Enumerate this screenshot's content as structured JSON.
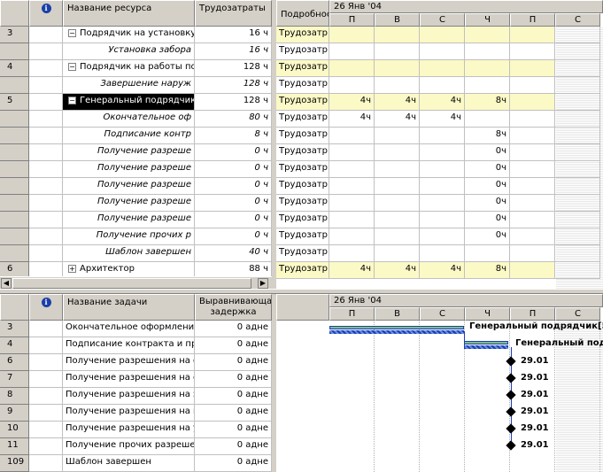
{
  "top": {
    "columns": {
      "name": "Название ресурса",
      "work": "Трудозатраты",
      "details": "Подробнос"
    },
    "timescale": {
      "week": "26 Янв '04",
      "days": [
        "П",
        "В",
        "С",
        "Ч",
        "П",
        "С"
      ]
    },
    "rows": [
      {
        "id": "3",
        "name": "Подрядчик на установку",
        "work": "16 ч",
        "detail": "Трудозатр",
        "cells": [
          "",
          "",
          "",
          "",
          "",
          ""
        ]
      },
      {
        "id": "",
        "name": "Установка забора",
        "work": "16 ч",
        "detail": "Трудозатр",
        "cells": [
          "",
          "",
          "",
          "",
          "",
          ""
        ]
      },
      {
        "id": "4",
        "name": "Подрядчик на работы по",
        "work": "128 ч",
        "detail": "Трудозатр",
        "cells": [
          "",
          "",
          "",
          "",
          "",
          ""
        ]
      },
      {
        "id": "",
        "name": "Завершение наруж",
        "work": "128 ч",
        "detail": "Трудозатр",
        "cells": [
          "",
          "",
          "",
          "",
          "",
          ""
        ]
      },
      {
        "id": "5",
        "name": "Генеральный подрядчик",
        "work": "128 ч",
        "detail": "Трудозатр",
        "cells": [
          "4ч",
          "4ч",
          "4ч",
          "8ч",
          "",
          ""
        ]
      },
      {
        "id": "",
        "name": "Окончательное оф",
        "work": "80 ч",
        "detail": "Трудозатр",
        "cells": [
          "4ч",
          "4ч",
          "4ч",
          "",
          "",
          ""
        ]
      },
      {
        "id": "",
        "name": "Подписание контр",
        "work": "8 ч",
        "detail": "Трудозатр",
        "cells": [
          "",
          "",
          "",
          "8ч",
          "",
          ""
        ]
      },
      {
        "id": "",
        "name": "Получение разреше",
        "work": "0 ч",
        "detail": "Трудозатр",
        "cells": [
          "",
          "",
          "",
          "0ч",
          "",
          ""
        ]
      },
      {
        "id": "",
        "name": "Получение разреше",
        "work": "0 ч",
        "detail": "Трудозатр",
        "cells": [
          "",
          "",
          "",
          "0ч",
          "",
          ""
        ]
      },
      {
        "id": "",
        "name": "Получение разреше",
        "work": "0 ч",
        "detail": "Трудозатр",
        "cells": [
          "",
          "",
          "",
          "0ч",
          "",
          ""
        ]
      },
      {
        "id": "",
        "name": "Получение разреше",
        "work": "0 ч",
        "detail": "Трудозатр",
        "cells": [
          "",
          "",
          "",
          "0ч",
          "",
          ""
        ]
      },
      {
        "id": "",
        "name": "Получение разреше",
        "work": "0 ч",
        "detail": "Трудозатр",
        "cells": [
          "",
          "",
          "",
          "0ч",
          "",
          ""
        ]
      },
      {
        "id": "",
        "name": "Получение прочих р",
        "work": "0 ч",
        "detail": "Трудозатр",
        "cells": [
          "",
          "",
          "",
          "0ч",
          "",
          ""
        ]
      },
      {
        "id": "",
        "name": "Шаблон завершен",
        "work": "40 ч",
        "detail": "Трудозатр",
        "cells": [
          "",
          "",
          "",
          "",
          "",
          ""
        ]
      },
      {
        "id": "6",
        "name": "Архитектор",
        "work": "88 ч",
        "detail": "Трудозатр",
        "cells": [
          "4ч",
          "4ч",
          "4ч",
          "8ч",
          "",
          ""
        ]
      }
    ]
  },
  "bottom": {
    "columns": {
      "name": "Название задачи",
      "leveling_line1": "Выравнивающа",
      "leveling_line2": "задержка"
    },
    "timescale": {
      "week": "26 Янв '04",
      "days": [
        "П",
        "В",
        "С",
        "Ч",
        "П",
        "С"
      ]
    },
    "rows": [
      {
        "id": "3",
        "name": "Окончательное оформление",
        "delay": "0 адне"
      },
      {
        "id": "4",
        "name": "Подписание контракта и пре",
        "delay": "0 адне"
      },
      {
        "id": "6",
        "name": "Получение разрешения на ф",
        "delay": "0 адне"
      },
      {
        "id": "7",
        "name": "Получение разрешения на с",
        "delay": "0 адне"
      },
      {
        "id": "8",
        "name": "Получение разрешения на э",
        "delay": "0 адне"
      },
      {
        "id": "9",
        "name": "Получение разрешения на г",
        "delay": "0 адне"
      },
      {
        "id": "10",
        "name": "Получение разрешения на у",
        "delay": "0 адне"
      },
      {
        "id": "11",
        "name": "Получение прочих разрешен",
        "delay": "0 адне"
      },
      {
        "id": "109",
        "name": "Шаблон завершен",
        "delay": "0 адне"
      }
    ],
    "bar_labels": [
      "Генеральный подрядчик[5",
      "Генеральный под"
    ],
    "milestone_labels": [
      "29.01",
      "29.01",
      "29.01",
      "29.01",
      "29.01",
      "29.01"
    ]
  },
  "colors": {
    "highlight": "#fbf9c6",
    "selection": "#000000",
    "bar_blue": "#1b3fb8",
    "bar_green": "#7fc07f"
  }
}
